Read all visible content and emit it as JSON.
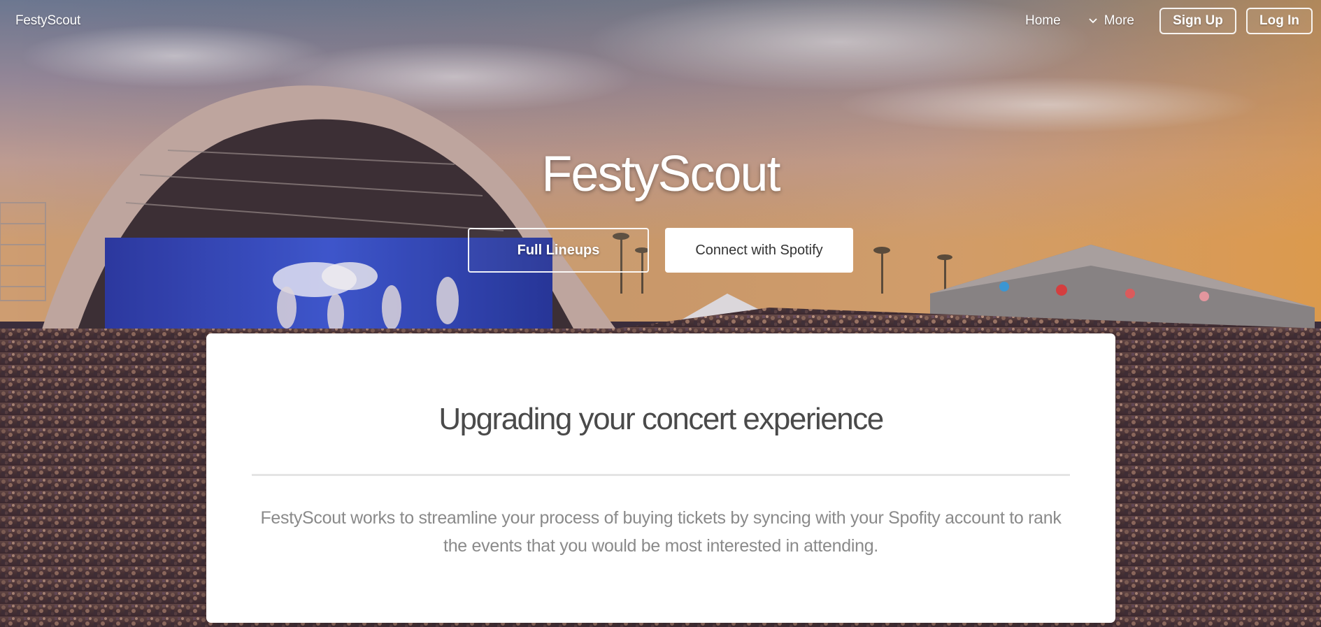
{
  "nav": {
    "brand": "FestyScout",
    "links": {
      "home": "Home",
      "more": "More"
    },
    "buttons": {
      "signup": "Sign Up",
      "login": "Log In"
    }
  },
  "hero": {
    "title": "FestyScout",
    "buttons": {
      "lineups": "Full Lineups",
      "spotify": "Connect with Spotify"
    },
    "background": "festival-stage-crowd-photo"
  },
  "card": {
    "title": "Upgrading your concert experience",
    "body": "FestyScout works to streamline your process of buying tickets by syncing with your Spofity account to rank the events that you would be most interested in attending."
  },
  "colors": {
    "card_background": "#ffffff",
    "card_title": "#4a4a4a",
    "card_body": "#8a8a8a",
    "divider": "#e4e4e4",
    "spotify_button_bg": "#ffffff",
    "nav_text": "#ffffff"
  },
  "icons": {
    "more_dropdown": "chevron-down-icon"
  }
}
